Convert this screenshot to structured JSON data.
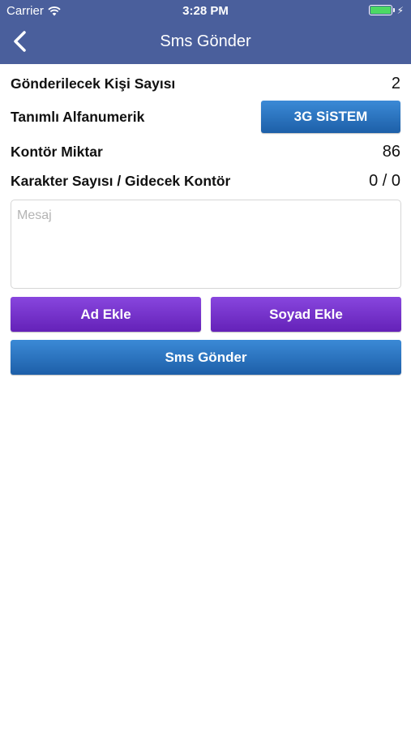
{
  "status_bar": {
    "carrier": "Carrier",
    "time": "3:28 PM",
    "battery_level_percent": 100,
    "battery_color": "#4cd964",
    "icons": [
      "wifi-icon",
      "battery-icon",
      "bolt-icon"
    ]
  },
  "nav": {
    "title": "Sms Gönder",
    "back_icon": "chevron-left-icon",
    "background_color": "#4a5f9c"
  },
  "info": {
    "recipient_count_label": "Gönderilecek Kişi Sayısı",
    "recipient_count_value": "2",
    "alphanumeric_label": "Tanımlı Alfanumerik",
    "alphanumeric_button": "3G SiSTEM",
    "credit_label": "Kontör Miktar",
    "credit_value": "86",
    "char_count_label": "Karakter Sayısı / Gidecek Kontör",
    "char_count_value": "0 / 0"
  },
  "message": {
    "placeholder": "Mesaj",
    "value": ""
  },
  "buttons": {
    "add_name": "Ad Ekle",
    "add_surname": "Soyad Ekle",
    "send": "Sms Gönder"
  },
  "colors": {
    "primary_blue": "#2a72c2",
    "purple": "#7434cc"
  }
}
